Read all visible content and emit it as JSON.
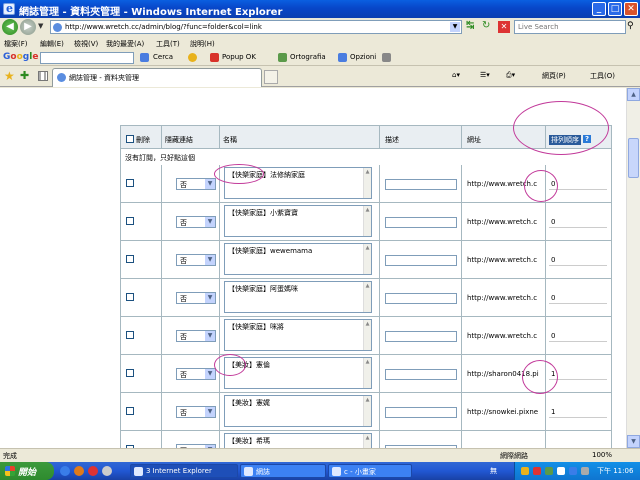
{
  "window": {
    "title": "網誌管理 - 資料夾管理 - Windows Internet Explorer",
    "min": "_",
    "max": "□",
    "close": "✕"
  },
  "address": {
    "url": "http://www.wretch.cc/admin/blog/?func=folder&col=link",
    "search_placeholder": "Live Search"
  },
  "menu": {
    "items": [
      "檔案(F)",
      "編輯(E)",
      "檢視(V)",
      "我的最愛(A)",
      "工具(T)",
      "說明(H)"
    ]
  },
  "google_bar": {
    "logo": "Google",
    "cerca": "Cerca",
    "popup": "Popup OK",
    "ortografia": "Ortografia",
    "opzioni": "Opzioni"
  },
  "tabs": {
    "active_label": "網誌管理 - 資料夾管理"
  },
  "command_bar": {
    "page": "網頁(P)",
    "tools": "工具(O)"
  },
  "table": {
    "headers": {
      "delete": "刪除",
      "hidden": "隱藏連結",
      "name": "名稱",
      "desc": "描述",
      "url": "網址",
      "order": "排列順序",
      "help": "?"
    },
    "no_subscribe": "沒有訂閱，只好點這個",
    "rows": [
      {
        "hidden": "否",
        "name": "【快樂家庭】法修納家庭",
        "url": "http://www.wretch.c",
        "order": "0"
      },
      {
        "hidden": "否",
        "name": "【快樂家庭】小紫寶寶",
        "url": "http://www.wretch.c",
        "order": "0"
      },
      {
        "hidden": "否",
        "name": "【快樂家庭】wewemama",
        "url": "http://www.wretch.c",
        "order": "0"
      },
      {
        "hidden": "否",
        "name": "【快樂家庭】阿蛋媽咪",
        "url": "http://www.wretch.c",
        "order": "0"
      },
      {
        "hidden": "否",
        "name": "【快樂家庭】咪將",
        "url": "http://www.wretch.c",
        "order": "0"
      },
      {
        "hidden": "否",
        "name": "【美妝】憲倫",
        "url": "http://sharon0418.pi",
        "order": "1"
      },
      {
        "hidden": "否",
        "name": "【美妝】憲娓",
        "url": "http://snowkei.pixne",
        "order": "1"
      },
      {
        "hidden": "否",
        "name": "【美妝】希瑪",
        "url": "",
        "order": ""
      }
    ]
  },
  "status": {
    "left": "完成",
    "zone": "網際網路",
    "zoom": "100%"
  },
  "taskbar": {
    "start": "開始",
    "tasks": [
      "3 Internet Explorer",
      "網誌",
      "c - 小畫家"
    ],
    "lang": "無",
    "clock": "下午 11:06"
  }
}
